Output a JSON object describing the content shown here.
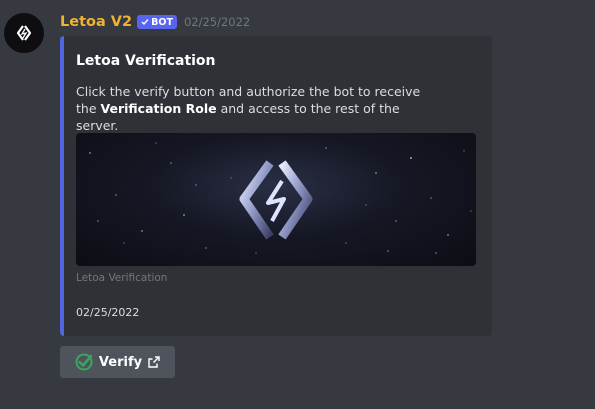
{
  "message": {
    "username": "Letoa V2",
    "bot_badge": "BOT",
    "timestamp": "02/25/2022",
    "avatar_icon": "letoa-logo-icon"
  },
  "embed": {
    "accent_color": "#4f66e0",
    "title": "Letoa Verification",
    "description_pre": "Click the verify button and authorize the bot to receive the ",
    "description_bold": "Verification Role",
    "description_post": " and access to the rest of the server.",
    "image_icon": "letoa-logo-icon",
    "image_caption": "Letoa Verification",
    "footer_timestamp": "02/25/2022"
  },
  "button": {
    "label": "Verify",
    "leading_icon": "check-emoji-icon",
    "trailing_icon": "external-link-icon"
  }
}
